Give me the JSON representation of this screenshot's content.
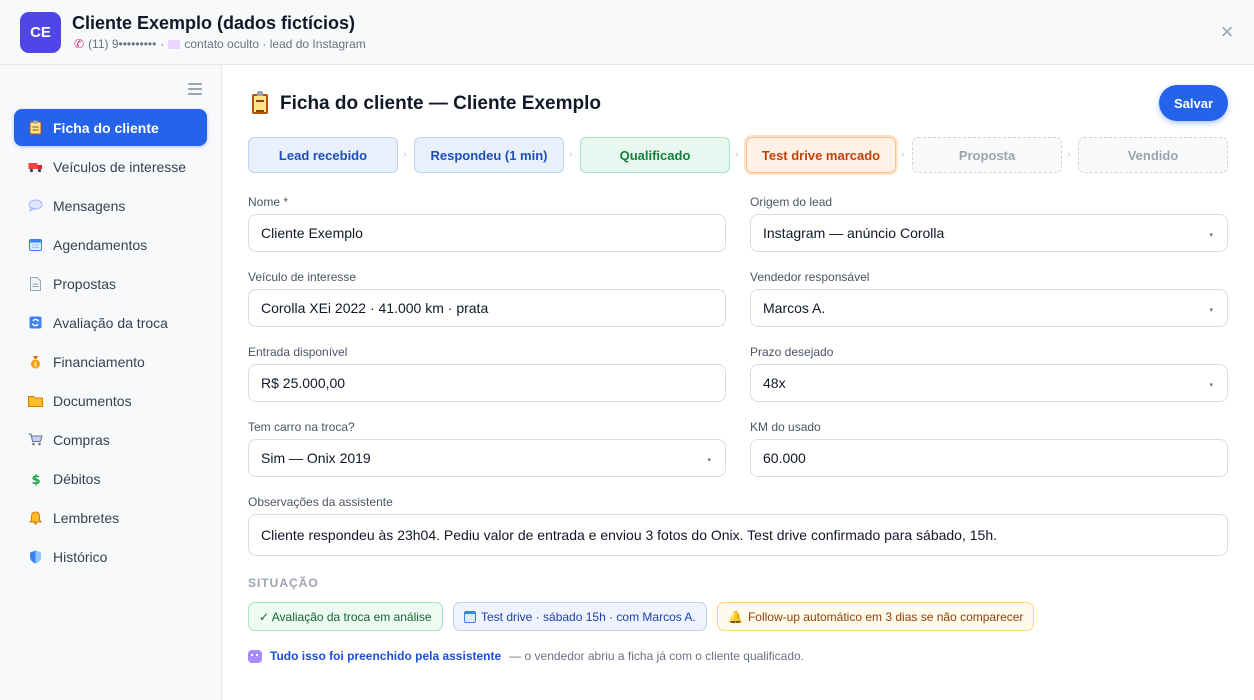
{
  "header": {
    "avatar_initials": "CE",
    "title": "Cliente Exemplo (dados fictícios)",
    "phone": "(11) 9•••••••••",
    "contact": "contato oculto · lead do Instagram",
    "close_symbol": "×",
    "accent": "#4f46e5"
  },
  "sidebar": {
    "items": [
      {
        "label": "Ficha do cliente",
        "icon": "clipboard-icon",
        "active": true
      },
      {
        "label": "Veículos de interesse",
        "icon": "truck-icon"
      },
      {
        "label": "Mensagens",
        "icon": "speech-bubble-icon"
      },
      {
        "label": "Agendamentos",
        "icon": "calendar-icon"
      },
      {
        "label": "Propostas",
        "icon": "document-icon"
      },
      {
        "label": "Avaliação da troca",
        "icon": "refresh-icon"
      },
      {
        "label": "Financiamento",
        "icon": "money-bag-icon"
      },
      {
        "label": "Documentos",
        "icon": "folder-icon"
      },
      {
        "label": "Compras",
        "icon": "cart-icon"
      },
      {
        "label": "Débitos",
        "icon": "dollar-icon"
      },
      {
        "label": "Lembretes",
        "icon": "bell-icon"
      },
      {
        "label": "Histórico",
        "icon": "shield-icon"
      }
    ]
  },
  "main": {
    "title": "Ficha do cliente — Cliente Exemplo",
    "save_label": "Salvar",
    "stages": [
      {
        "label": "Lead recebido",
        "state": "done"
      },
      {
        "label": "Respondeu (1 min)",
        "state": "done"
      },
      {
        "label": "Qualificado",
        "state": "qualified"
      },
      {
        "label": "Test drive marcado",
        "state": "current"
      },
      {
        "label": "Proposta",
        "state": "pending"
      },
      {
        "label": "Vendido",
        "state": "pending"
      }
    ],
    "form": {
      "nome_label": "Nome *",
      "nome_value": "Cliente Exemplo",
      "origem_label": "Origem do lead",
      "origem_value": "Instagram — anúncio Corolla",
      "veiculo_label": "Veículo de interesse",
      "veiculo_value": "Corolla XEi 2022 · 41.000 km · prata",
      "vendedor_label": "Vendedor responsável",
      "vendedor_value": "Marcos A.",
      "entrada_label": "Entrada disponível",
      "entrada_value": "R$ 25.000,00",
      "prazo_label": "Prazo desejado",
      "prazo_value": "48x",
      "troca_label": "Tem carro na troca?",
      "troca_value": "Sim — Onix 2019",
      "km_label": "KM do usado",
      "km_value": "60.000",
      "obs_label": "Observações da assistente",
      "obs_value": "Cliente respondeu às 23h04. Pediu valor de entrada e enviou 3 fotos do Onix. Test drive confirmado para sábado, 15h."
    },
    "situacao": {
      "title": "SITUAÇÃO",
      "chips": [
        {
          "label": "✓ Avaliação da troca em análise",
          "color": "#166534"
        },
        {
          "label": "Test drive · sábado 15h · com Marcos A.",
          "color": "#1e40af"
        },
        {
          "label": "Follow-up automático em 3 dias se não comparecer",
          "color": "#92400e"
        }
      ]
    },
    "footer": {
      "strong": "Tudo isso foi preenchido pela assistente",
      "rest": "— o vendedor abriu a ficha já com o cliente qualificado."
    }
  }
}
